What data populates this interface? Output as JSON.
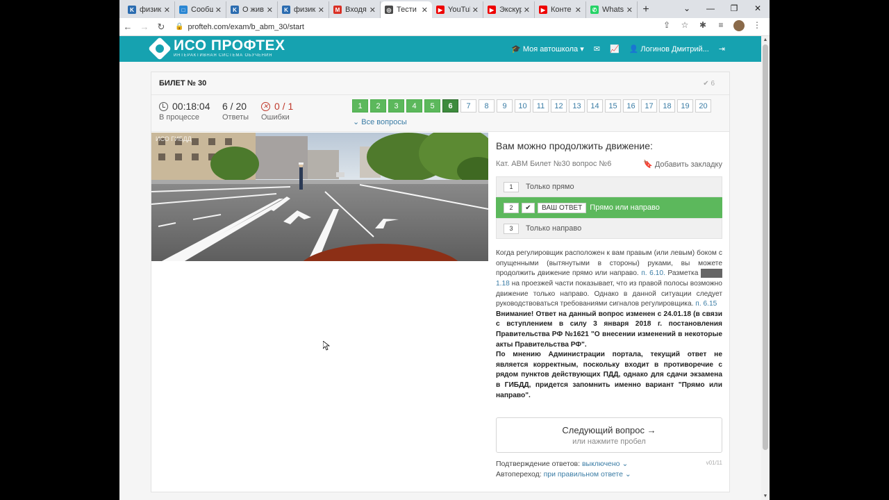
{
  "browser": {
    "tabs": [
      {
        "label": "физик",
        "color": "#2b6cb0",
        "glyph": "K"
      },
      {
        "label": "Сообщ",
        "color": "#2b87d3",
        "glyph": "□"
      },
      {
        "label": "О жив",
        "color": "#2b6cb0",
        "glyph": "K"
      },
      {
        "label": "физик",
        "color": "#2b6cb0",
        "glyph": "K"
      },
      {
        "label": "Входя",
        "color": "#d93025",
        "glyph": "M"
      },
      {
        "label": "Тести",
        "color": "#4a4a4a",
        "glyph": "◎",
        "active": true
      },
      {
        "label": "YouTul",
        "color": "#e00",
        "glyph": "▶"
      },
      {
        "label": "Экскур",
        "color": "#e00",
        "glyph": "▶"
      },
      {
        "label": "Конте",
        "color": "#e00",
        "glyph": "▶"
      },
      {
        "label": "Whats",
        "color": "#25d366",
        "glyph": "✆"
      }
    ],
    "new_tab": "+",
    "url": "profteh.com/exam/b_abm_30/start"
  },
  "site": {
    "logo_title": "ИСО ПРОФТЕХ",
    "logo_subtitle": "ИНТЕРАКТИВНАЯ СИСТЕМА ОБУЧЕНИЯ",
    "nav_school": "Моя автошкола",
    "nav_user": "Логинов Дмитрий..."
  },
  "exam": {
    "ticket_title": "БИЛЕТ № 30",
    "ticket_check": "6",
    "timer": "00:18:04",
    "timer_label": "В процессе",
    "answers_count": "6 / 20",
    "answers_label": "Ответы",
    "errors_count": "0 / 1",
    "errors_label": "Ошибки",
    "all_questions": "Все вопросы",
    "current_question": 6,
    "total_questions": 20,
    "question_text": "Вам можно продолжить движение:",
    "meta": "Кат. ABM  Билет №30  вопрос №6",
    "bookmark": "Добавить закладку",
    "answers": [
      {
        "num": "1",
        "text": "Только прямо"
      },
      {
        "num": "2",
        "text": "Прямо или направо",
        "badge": "ВАШ ОТВЕТ"
      },
      {
        "num": "3",
        "text": "Только направо"
      }
    ],
    "next_title": "Следующий вопрос →",
    "next_sub": "или нажмите пробел",
    "confirm_label": "Подтверждение ответов:",
    "confirm_value": "выключено",
    "auto_label": "Автопереход:",
    "auto_value": "при правильном ответе",
    "version": "v01/11",
    "photo_caption": "ИСО ГИБДД",
    "explanation": {
      "p1": "Когда регулировщик расположен к вам правым (или левым) боком с опущенными (вытянутыми в стороны) руками, вы можете продолжить движение прямо или направо.",
      "link1": "п. 6.10.",
      "p2": "Разметка",
      "link2": "1.18",
      "p3": "на проезжей части показывает, что из правой полосы возможно движение только направо. Однако в данной ситуации следует руководствоваться требованиями сигналов регулировщика.",
      "link3": "п. 6.15",
      "bold1": "Внимание! Ответ на данный вопрос изменен с 24.01.18 (в связи с вступлением в силу 3 января 2018 г. постановления Правительства РФ №1621 \"О внесении изменений в некоторые акты Правительства РФ\".",
      "bold2": "По мнению Администрации портала, текущий ответ не является корректным, поскольку входит в противоречие с рядом пунктов действующих ПДД, однако для сдачи экзамена в ГИБДД, придется запомнить именно вариант \"Прямо или направо\"."
    }
  }
}
